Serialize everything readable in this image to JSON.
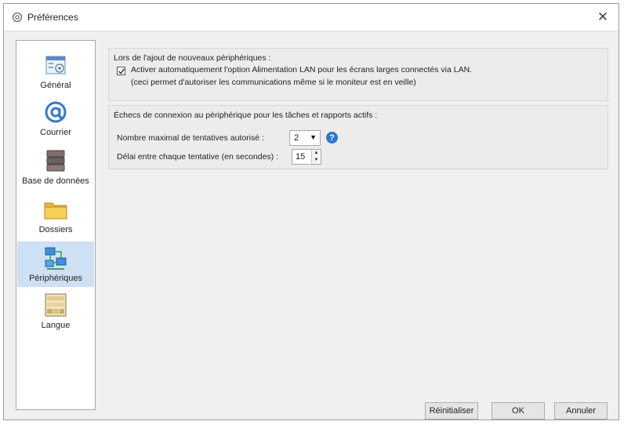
{
  "window": {
    "title": "Préférences",
    "close_glyph": "✕",
    "icon": "gear-icon"
  },
  "sidebar": {
    "items": [
      {
        "label": "Général",
        "icon": "general-settings-icon",
        "selected": false
      },
      {
        "label": "Courrier",
        "icon": "at-sign-icon",
        "selected": false
      },
      {
        "label": "Base de données",
        "icon": "database-icon",
        "selected": false
      },
      {
        "label": "Dossiers",
        "icon": "folder-icon",
        "selected": false
      },
      {
        "label": "Périphériques",
        "icon": "network-devices-icon",
        "selected": true
      },
      {
        "label": "Langue",
        "icon": "language-icon",
        "selected": false
      }
    ]
  },
  "group_add": {
    "title": "Lors de l'ajout de nouveaux périphériques :",
    "checkbox_checked": true,
    "checkbox_label": "Activer automatiquement l'option Alimentation LAN pour les écrans larges connectés via LAN.",
    "checkbox_sub": "(ceci permet d'autoriser les communications même si le moniteur est en veille)"
  },
  "group_fail": {
    "title": "Échecs de connexion au périphérique pour les tâches et rapports actifs :",
    "max_attempts_label": "Nombre maximal de tentatives autorisé :",
    "max_attempts_value": "2",
    "delay_label": "Délai entre chaque tentative (en secondes) :",
    "delay_value": "15"
  },
  "buttons": {
    "reset": "Réinitialiser",
    "ok": "OK",
    "cancel": "Annuler"
  },
  "colors": {
    "selection": "#cde0f4",
    "help": "#2f76c8"
  }
}
